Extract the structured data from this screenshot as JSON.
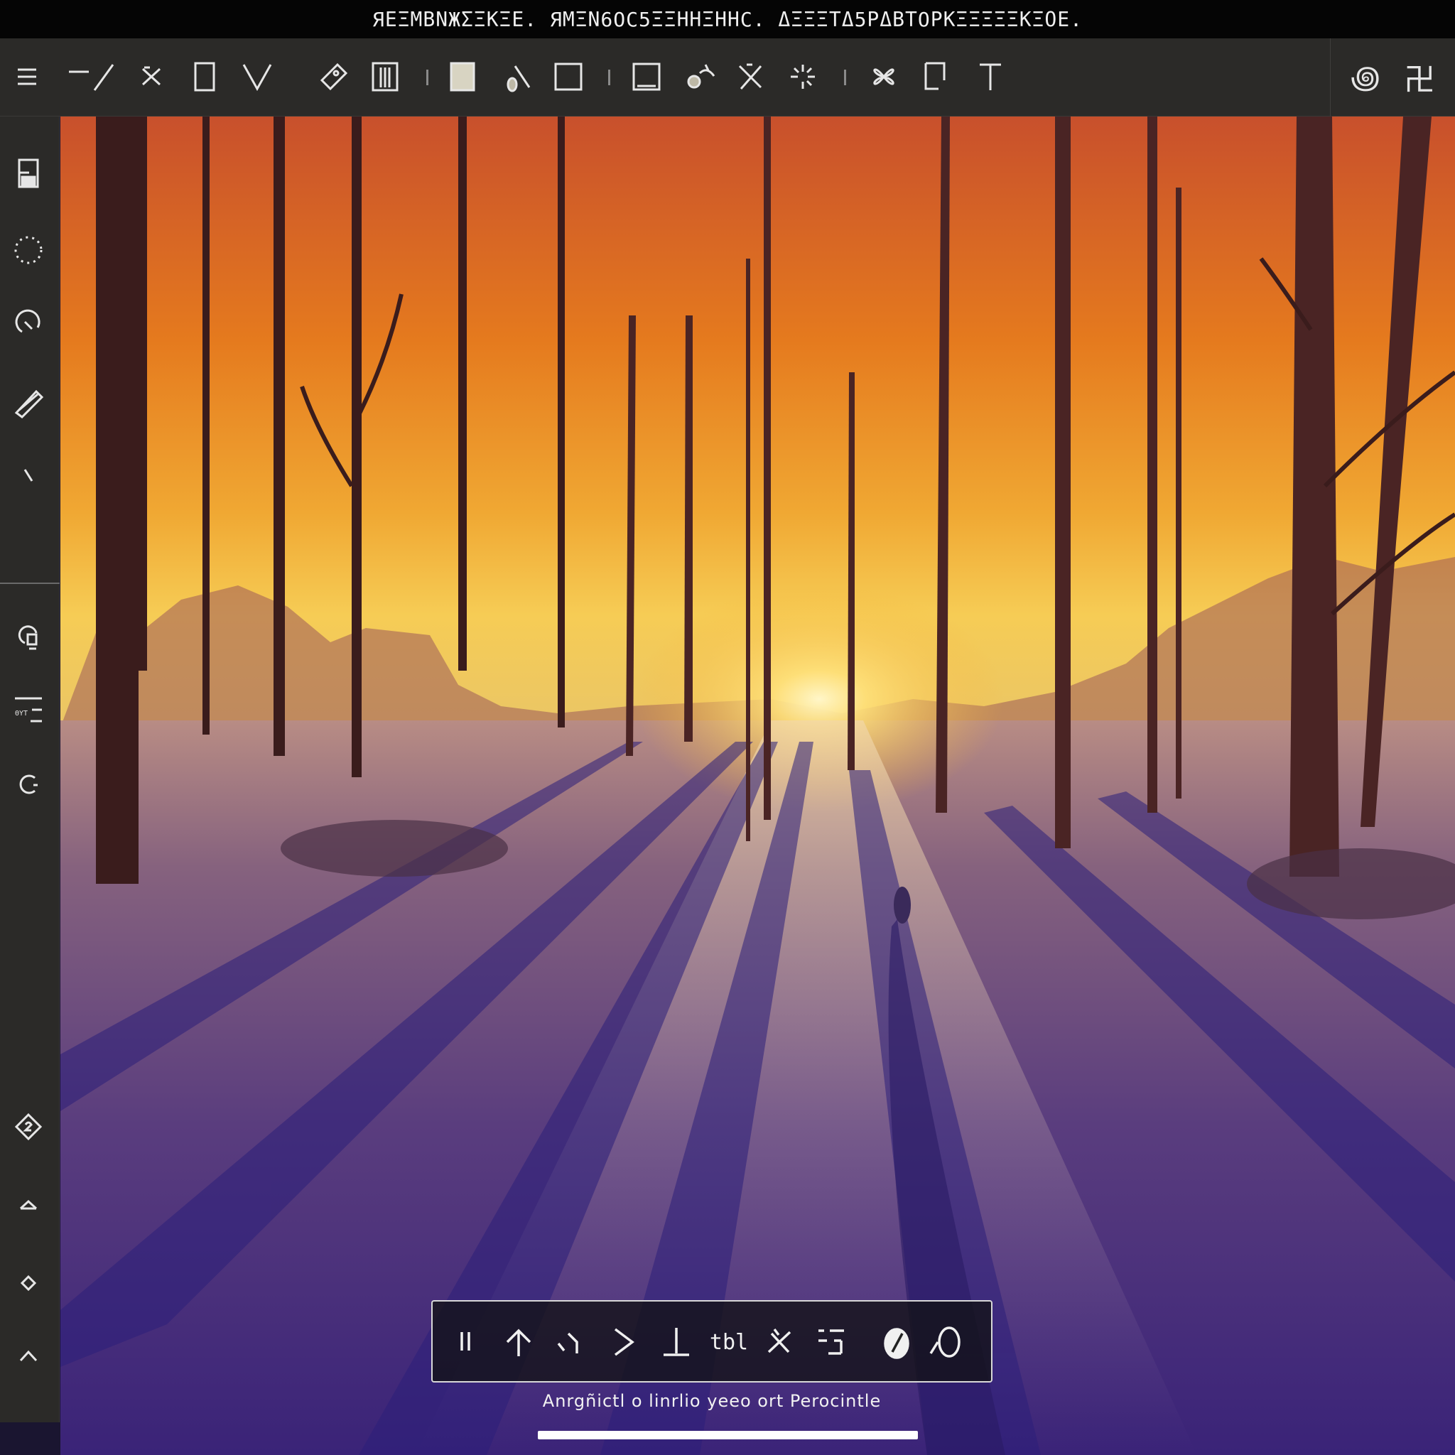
{
  "titlebar": {
    "text": "ЯΕΞΜΒΝЖΣΞΚΞΕ. ЯΜΞΝ6ОС5ΞΞΗΗΞΗΗС. ΔΞΞΞΤΔ5ΡΔΒΤОΡΚΞΞΞΞΞΚΞΟΕ."
  },
  "toolbar": {
    "left_items": [
      {
        "name": "menu-icon"
      },
      {
        "name": "line-icon"
      },
      {
        "name": "scissors-icon"
      },
      {
        "name": "rectangle-select-icon"
      },
      {
        "name": "chevron-down-icon"
      },
      {
        "name": "eraser-icon"
      },
      {
        "name": "columns-icon"
      },
      {
        "name": "filled-square-icon"
      },
      {
        "name": "brush-icon"
      },
      {
        "name": "square-icon"
      },
      {
        "name": "frame-icon"
      },
      {
        "name": "lasso-icon"
      },
      {
        "name": "transform-icon"
      },
      {
        "name": "sparkle-icon"
      },
      {
        "name": "symmetry-icon"
      },
      {
        "name": "crop-icon"
      },
      {
        "name": "text-icon"
      }
    ],
    "right_items": [
      {
        "name": "layers-icon",
        "glyph": "꩜"
      },
      {
        "name": "settings-icon",
        "glyph": "卍"
      }
    ]
  },
  "sidebar": {
    "items": [
      {
        "name": "save-icon"
      },
      {
        "name": "dotted-circle-icon"
      },
      {
        "name": "refresh-icon"
      },
      {
        "name": "pencil-icon"
      },
      {
        "name": "slash-icon"
      },
      {
        "name": "bulb-icon"
      },
      {
        "name": "adjust-lines-icon"
      },
      {
        "name": "redo-icon"
      },
      {
        "name": "diamond-icon"
      },
      {
        "name": "caret-up-icon"
      },
      {
        "name": "small-diamond-icon"
      },
      {
        "name": "chevron-up-icon"
      }
    ],
    "adjust_label": "ΘΥΤ"
  },
  "float_toolbar": {
    "items": [
      {
        "name": "pause-icon"
      },
      {
        "name": "arrow-up-icon"
      },
      {
        "name": "curve-arrow-icon"
      },
      {
        "name": "chevron-right-icon"
      },
      {
        "name": "baseline-icon"
      },
      {
        "name": "text-tool-icon",
        "label": "tbl"
      },
      {
        "name": "magic-icon"
      },
      {
        "name": "grid-icon"
      },
      {
        "name": "color-drop-icon"
      },
      {
        "name": "opacity-icon"
      }
    ]
  },
  "caption": {
    "text": "Anrgñictl o linrlio yeeo ort Perocintle"
  },
  "colors": {
    "chrome": "#2b2a28",
    "sky_top": "#c9502a",
    "sky_mid": "#e8841c",
    "sky_horizon": "#f6c548",
    "ground": "#5a3e78",
    "ground_dark": "#2c1d6e"
  }
}
